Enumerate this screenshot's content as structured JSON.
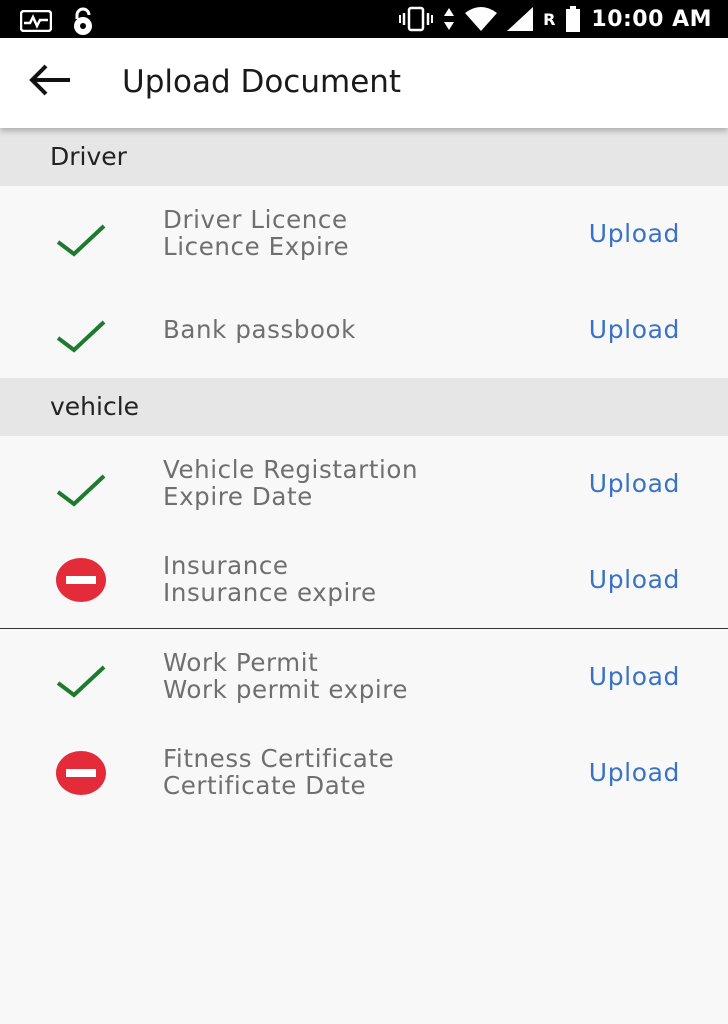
{
  "status_bar": {
    "time": "10:00 AM",
    "roaming_indicator": "R",
    "icons": [
      "activity-icon",
      "lock-icon",
      "vibrate-icon",
      "data-arrows-icon",
      "wifi-icon",
      "signal-icon",
      "battery-icon"
    ]
  },
  "app_bar": {
    "title": "Upload Document",
    "back_icon": "arrow-back-icon"
  },
  "sections": [
    {
      "header": "Driver",
      "items": [
        {
          "line1": "Driver Licence",
          "line2": "Licence Expire",
          "status": "uploaded",
          "action": "Upload"
        },
        {
          "line1": "Bank passbook",
          "line2": "",
          "status": "uploaded",
          "action": "Upload"
        }
      ]
    },
    {
      "header": "vehicle",
      "items": [
        {
          "line1": "Vehicle Registartion",
          "line2": "Expire Date",
          "status": "uploaded",
          "action": "Upload"
        },
        {
          "line1": "Insurance",
          "line2": "Insurance expire",
          "status": "missing",
          "action": "Upload"
        },
        {
          "line1": "Work Permit",
          "line2": "Work permit expire",
          "status": "uploaded",
          "action": "Upload"
        },
        {
          "line1": "Fitness Certificate",
          "line2": "Certificate Date",
          "status": "missing",
          "action": "Upload"
        }
      ]
    }
  ],
  "colors": {
    "check_green": "#1e7a2e",
    "missing_red": "#e32b3a",
    "link_blue": "#3a73c4",
    "section_bg": "#e6e6e6"
  }
}
